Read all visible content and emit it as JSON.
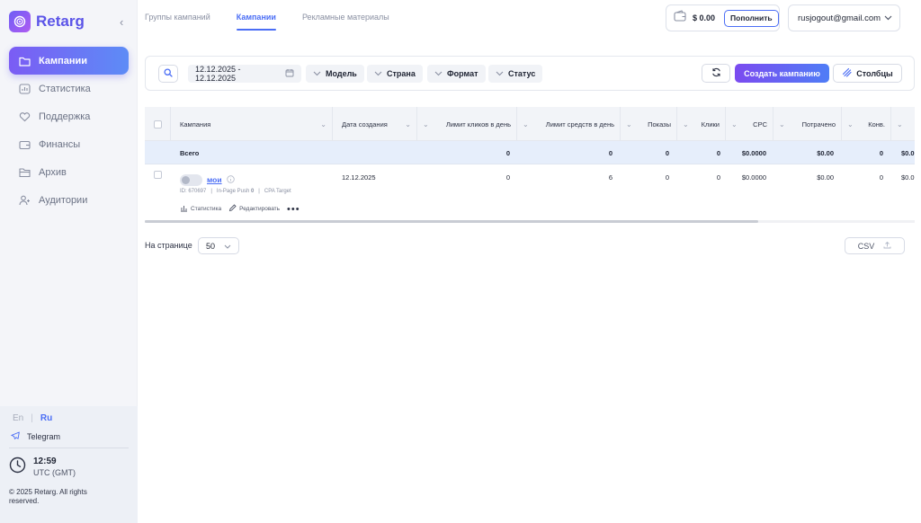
{
  "app": {
    "logo_text": "Retarg"
  },
  "sidebar": {
    "items": [
      {
        "label": "Кампании",
        "icon": "folder-icon",
        "active": true
      },
      {
        "label": "Статистика",
        "icon": "bar-chart-icon"
      },
      {
        "label": "Поддержка",
        "icon": "heart-icon"
      },
      {
        "label": "Финансы",
        "icon": "wallet-icon"
      },
      {
        "label": "Архив",
        "icon": "archive-icon"
      },
      {
        "label": "Аудитории",
        "icon": "user-plus-icon"
      }
    ],
    "lang_en": "En",
    "lang_ru": "Ru",
    "telegram": "Telegram",
    "time": "12:59",
    "timezone": "UTC (GMT)",
    "copyright": "© 2025 Retarg. All rights reserved."
  },
  "header": {
    "tabs": [
      {
        "label": "Группы кампаний"
      },
      {
        "label": "Кампании",
        "active": true
      },
      {
        "label": "Рекламные материалы"
      }
    ],
    "balance": "$ 0.00",
    "topup_label": "Пополнить",
    "user_email": "rusjogout@gmail.com"
  },
  "filters": {
    "date_range": "12.12.2025 - 12.12.2025",
    "chips": [
      "Модель",
      "Страна",
      "Формат",
      "Статус"
    ],
    "create_label": "Создать кампанию",
    "columns_label": "Столбцы"
  },
  "table": {
    "columns": [
      "Кампания",
      "Дата создания",
      "Лимит кликов в день",
      "Лимит средств в день",
      "Показы",
      "Клики",
      "CPC",
      "Потрачено",
      "Конв.",
      ""
    ],
    "total": {
      "label": "Всего",
      "clicks_limit": "0",
      "funds_limit": "0",
      "impressions": "0",
      "clicks": "0",
      "cpc": "$0.0000",
      "spent": "$0.00",
      "conv": "0",
      "extra": "$0.0"
    },
    "rows": [
      {
        "name": "мои",
        "id_text": "ID: 670697",
        "format": "In-Page Push",
        "format_count": "0",
        "model": "CPA Target",
        "stats_action": "Статистика",
        "edit_action": "Редактировать",
        "created": "12.12.2025",
        "clicks_limit": "0",
        "funds_limit": "6",
        "impressions": "0",
        "clicks": "0",
        "cpc": "$0.0000",
        "spent": "$0.00",
        "conv": "0",
        "extra": "$0.0"
      }
    ]
  },
  "footer": {
    "per_page_label": "На странице",
    "per_page_value": "50",
    "csv_label": "CSV"
  }
}
